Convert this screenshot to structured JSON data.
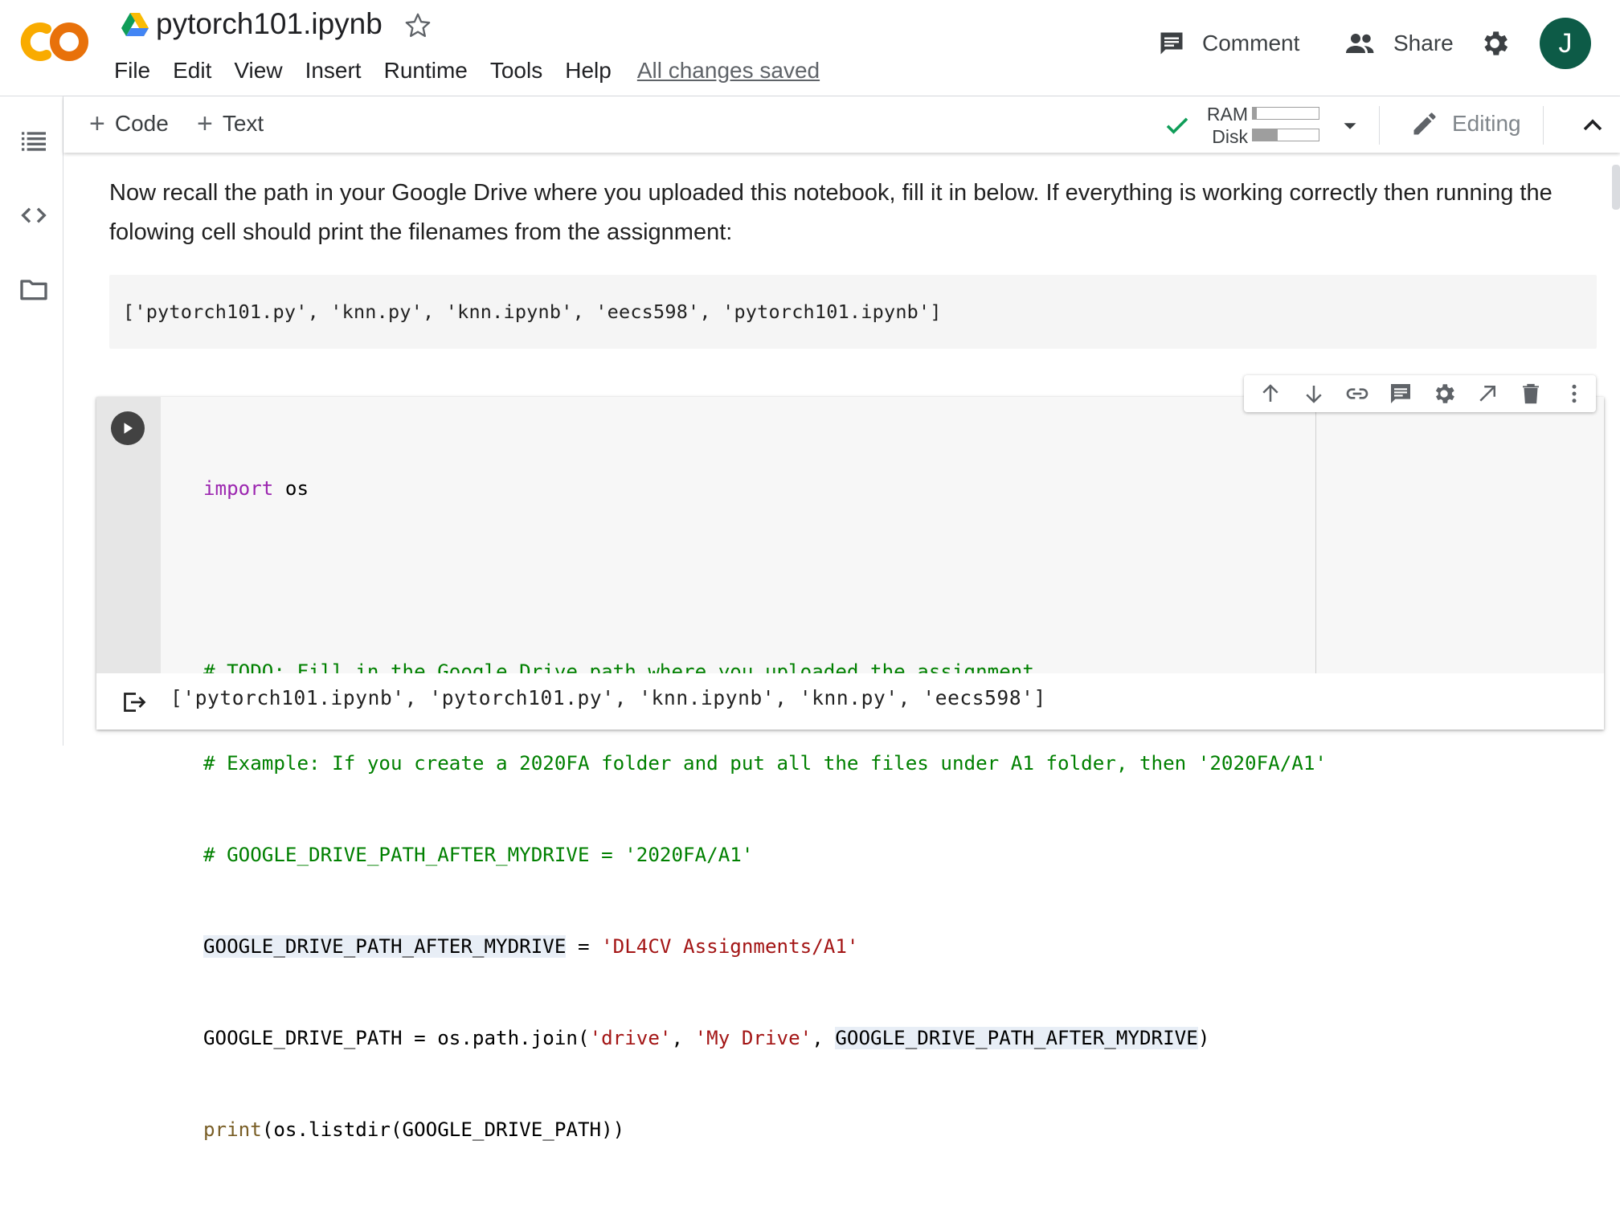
{
  "header": {
    "title": "pytorch101.ipynb",
    "menu": [
      "File",
      "Edit",
      "View",
      "Insert",
      "Runtime",
      "Tools",
      "Help"
    ],
    "save_status": "All changes saved",
    "comment_label": "Comment",
    "share_label": "Share",
    "avatar_initial": "J",
    "avatar_color": "#0d5b47"
  },
  "left_rail": {
    "icons": [
      "table-of-contents-icon",
      "code-snippets-icon",
      "files-folder-icon"
    ]
  },
  "toolbar": {
    "add_code_label": "Code",
    "add_text_label": "Text",
    "ram_label": "RAM",
    "disk_label": "Disk",
    "ram_usage_fraction": 0.06,
    "disk_usage_fraction": 0.38,
    "mode_label": "Editing"
  },
  "notebook": {
    "text_cell": "Now recall the path in your Google Drive where you uploaded this notebook, fill it in below. If everything is working correctly then running the folowing cell should print the filenames from the assignment:",
    "text_cell_output": "['pytorch101.py', 'knn.py', 'knn.ipynb', 'eecs598', 'pytorch101.ipynb']",
    "code_cell": {
      "line1_keyword": "import",
      "line1_rest": " os",
      "line3_comment": "# TODO: Fill in the Google Drive path where you uploaded the assignment",
      "line4_comment": "# Example: If you create a 2020FA folder and put all the files under A1 folder, then '2020FA/A1'",
      "line5_comment": "# GOOGLE_DRIVE_PATH_AFTER_MYDRIVE = '2020FA/A1'",
      "line6_var": "GOOGLE_DRIVE_PATH_AFTER_MYDRIVE",
      "line6_op": " = ",
      "line6_str": "'DL4CV Assignments/A1'",
      "line7_pre": "GOOGLE_DRIVE_PATH = os.path.join(",
      "line7_str1": "'drive'",
      "line7_sep1": ", ",
      "line7_str2": "'My Drive'",
      "line7_sep2": ", ",
      "line7_var": "GOOGLE_DRIVE_PATH_AFTER_MYDRIVE",
      "line7_post": ")",
      "line8_fn": "print",
      "line8_rest": "(os.listdir(GOOGLE_DRIVE_PATH))",
      "output": "['pytorch101.ipynb', 'pytorch101.py', 'knn.ipynb', 'knn.py', 'eecs598']"
    },
    "cell_toolbar_icons": [
      "move-up-icon",
      "move-down-icon",
      "link-icon",
      "comment-icon",
      "settings-icon",
      "open-in-tab-icon",
      "delete-icon",
      "more-options-icon"
    ]
  },
  "colors": {
    "keyword": "#9c27b0",
    "comment": "#008000",
    "string": "#a31515",
    "builtin": "#795e26",
    "ram_ok": "#0f9d58"
  }
}
